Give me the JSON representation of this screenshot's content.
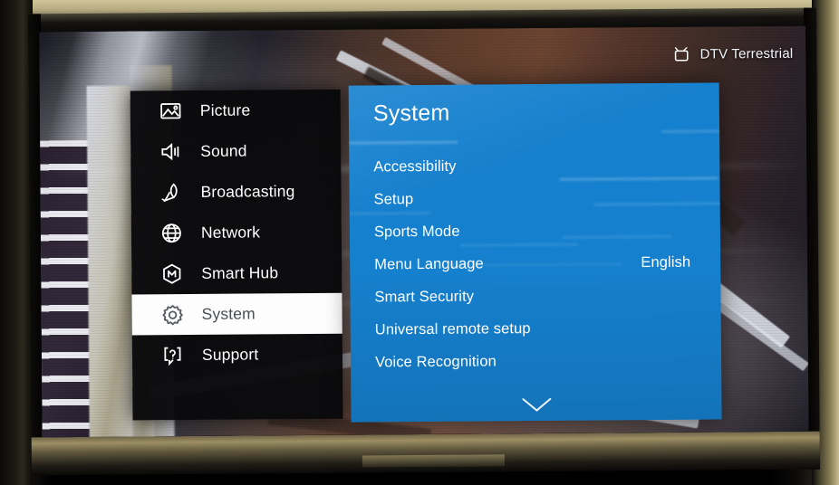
{
  "device": {
    "type": "smart-tv-settings-menu",
    "brand_style": "samsung-tizen"
  },
  "statusbar": {
    "source_icon": "tv-icon",
    "source_label": "DTV Terrestrial"
  },
  "main_menu": {
    "items": [
      {
        "label": "Picture",
        "icon": "picture-icon",
        "selected": false
      },
      {
        "label": "Sound",
        "icon": "speaker-icon",
        "selected": false
      },
      {
        "label": "Broadcasting",
        "icon": "satellite-dish-icon",
        "selected": false
      },
      {
        "label": "Network",
        "icon": "globe-icon",
        "selected": false
      },
      {
        "label": "Smart Hub",
        "icon": "smart-hub-icon",
        "selected": false
      },
      {
        "label": "System",
        "icon": "gear-icon",
        "selected": true
      },
      {
        "label": "Support",
        "icon": "help-bubble-icon",
        "selected": false
      }
    ]
  },
  "submenu": {
    "title": "System",
    "scroll_indicator_icon": "chevron-down-icon",
    "items": [
      {
        "label": "Accessibility",
        "value": ""
      },
      {
        "label": "Setup",
        "value": ""
      },
      {
        "label": "Sports Mode",
        "value": ""
      },
      {
        "label": "Menu Language",
        "value": "English"
      },
      {
        "label": "Smart Security",
        "value": ""
      },
      {
        "label": "Universal remote setup",
        "value": ""
      },
      {
        "label": "Voice Recognition",
        "value": ""
      }
    ]
  },
  "colors": {
    "submenu_blue": "#1580ce",
    "menu_black": "#090909",
    "selected_row_bg": "#fdfdfd",
    "selected_row_text": "#4b4e55",
    "menu_text": "#ffffff"
  }
}
